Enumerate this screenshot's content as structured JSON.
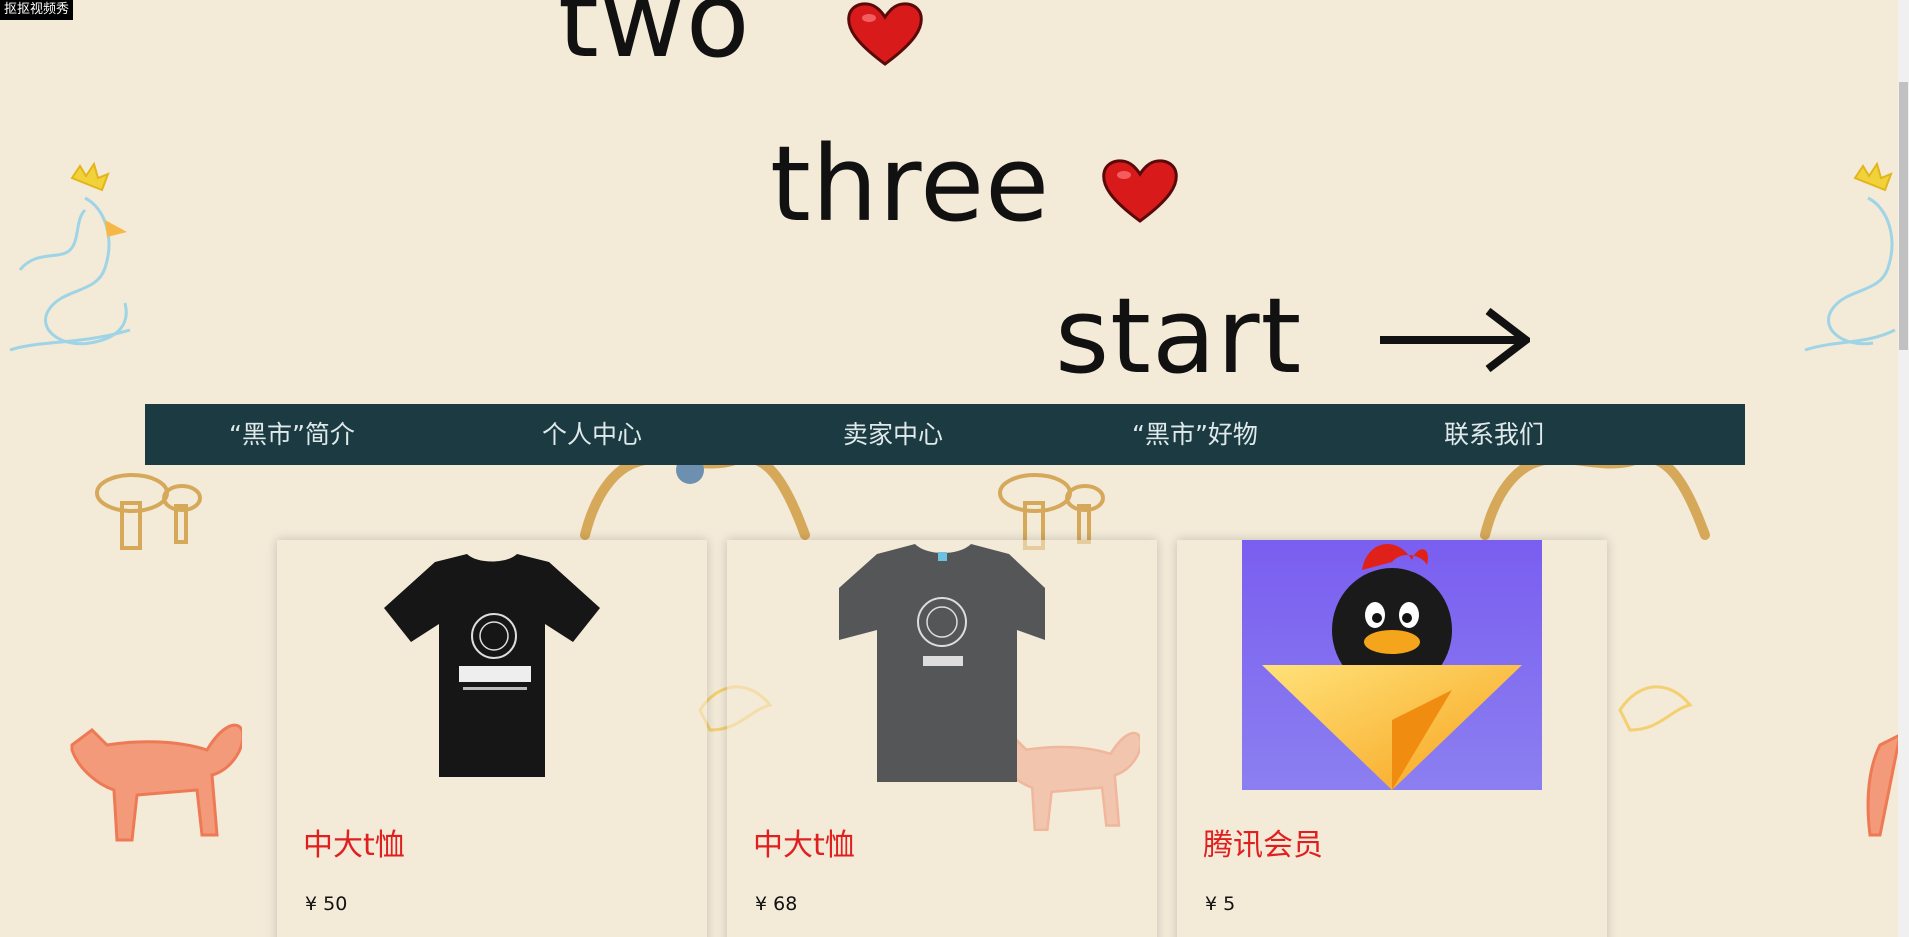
{
  "watermark": "抠抠视频秀",
  "hero": {
    "word_two": "two",
    "word_three": "three",
    "word_start": "start",
    "heart_icon": "heart-icon",
    "arrow_icon": "right-arrow-icon"
  },
  "nav": {
    "items": [
      {
        "label": "“黑市”简介"
      },
      {
        "label": "个人中心"
      },
      {
        "label": "卖家中心"
      },
      {
        "label": "“黑市”好物"
      },
      {
        "label": "联系我们"
      }
    ],
    "background": "#1c3a42"
  },
  "products": [
    {
      "title": "中大t恤",
      "price": "¥ 50",
      "image": "black-tshirt-image"
    },
    {
      "title": "中大t恤",
      "price": "¥ 68",
      "image": "grey-tshirt-image"
    },
    {
      "title": "腾讯会员",
      "price": "¥ 5",
      "image": "qq-penguin-image"
    }
  ],
  "colors": {
    "page_background": "#f3ead8",
    "product_title": "#e01f1f",
    "nav_text": "#dfe9ea"
  }
}
